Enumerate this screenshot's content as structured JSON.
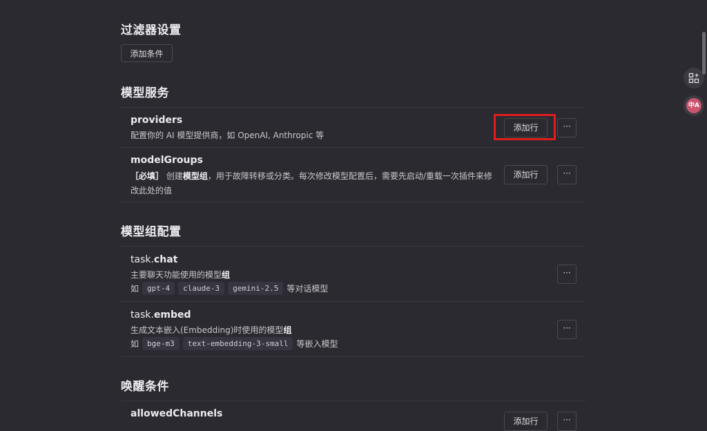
{
  "filter": {
    "title": "过滤器设置",
    "add_condition": "添加条件"
  },
  "model_service": {
    "title": "模型服务",
    "providers": {
      "name": "providers",
      "desc": "配置你的 AI 模型提供商，如 OpenAI, Anthropic 等",
      "add_row": "添加行",
      "more": "···"
    },
    "modelGroups": {
      "name": "modelGroups",
      "desc_tag": "［必填］",
      "desc_1": " 创建",
      "desc_bold": "模型组",
      "desc_2": "，用于故障转移或分类。每次修改模型配置后，需要先启动/重载一次插件来修",
      "desc_3": "改此处的值",
      "add_row": "添加行",
      "more": "···"
    }
  },
  "group_config": {
    "title": "模型组配置",
    "chat": {
      "prefix": "task.",
      "name": "chat",
      "desc_1": "主要聊天功能使用的模型",
      "desc_bold": "组",
      "ex_prefix": "如",
      "examples": [
        "gpt-4",
        "claude-3",
        "gemini-2.5"
      ],
      "ex_suffix": "等对话模型",
      "more": "···"
    },
    "embed": {
      "prefix": "task.",
      "name": "embed",
      "desc_1": "生成文本嵌入(Embedding)时使用的模型",
      "desc_bold": "组",
      "ex_prefix": "如",
      "examples": [
        "bge-m3",
        "text-embedding-3-small"
      ],
      "ex_suffix": "等嵌入模型",
      "more": "···"
    }
  },
  "wake": {
    "title": "唤醒条件",
    "allowedChannels": {
      "name": "allowedChannels",
      "add_row": "添加行",
      "more": "···"
    }
  },
  "side": {
    "grid_icon": "grid-plus-icon",
    "translate_icon": "translate-icon",
    "translate_text": "中A"
  },
  "colors": {
    "background": "#2b2a30",
    "highlight": "#e11d1d"
  }
}
